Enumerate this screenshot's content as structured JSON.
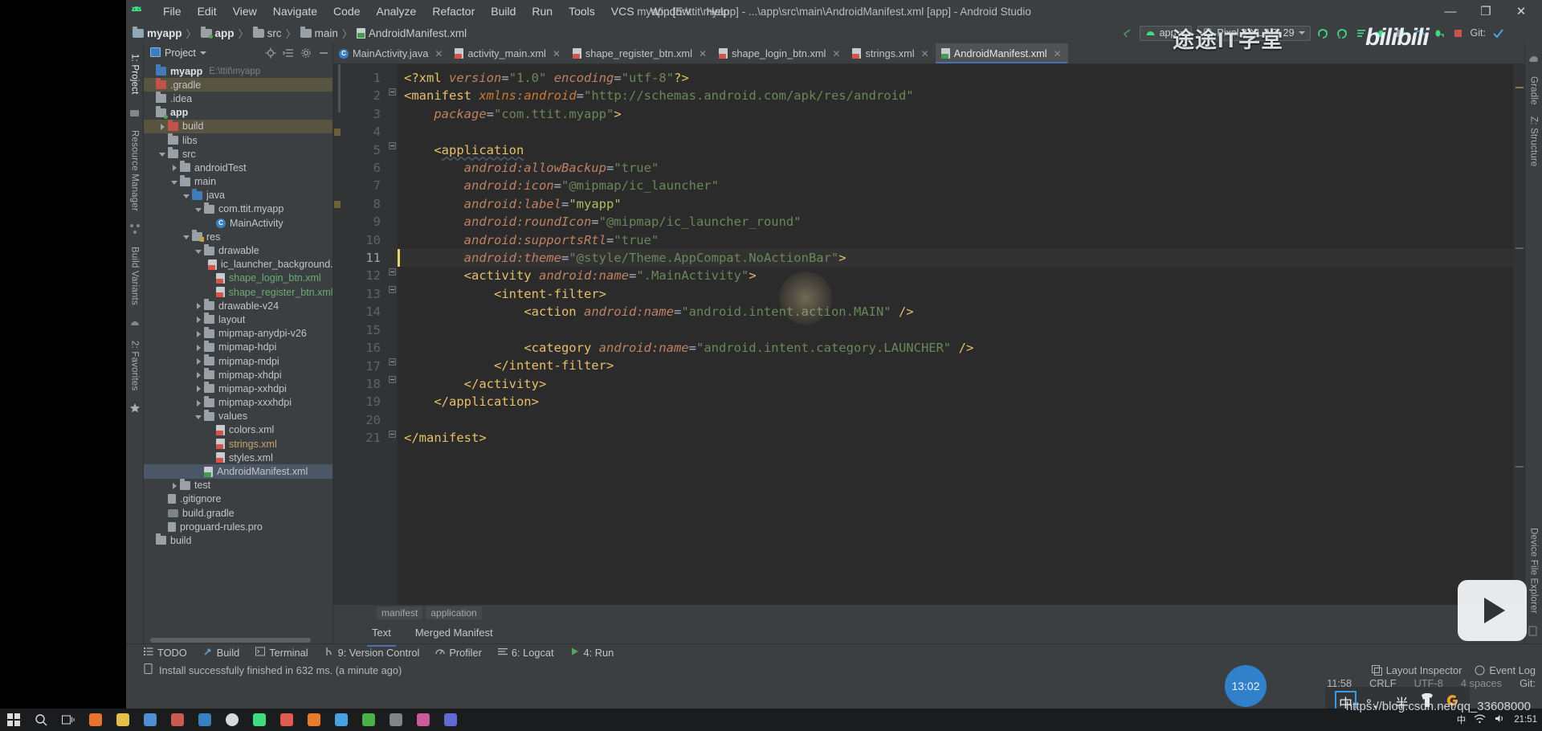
{
  "window": {
    "title": "myapp [E:\\ttit\\myapp] - ...\\app\\src\\main\\AndroidManifest.xml [app] - Android Studio",
    "minimize": "—",
    "maximize": "❐",
    "close": "✕"
  },
  "menubar": {
    "items": [
      "File",
      "Edit",
      "View",
      "Navigate",
      "Code",
      "Analyze",
      "Refactor",
      "Build",
      "Run",
      "Tools",
      "VCS",
      "Window",
      "Help"
    ]
  },
  "breadcrumb": {
    "items": [
      "myapp",
      "app",
      "src",
      "main",
      "AndroidManifest.xml"
    ],
    "separator": "〉"
  },
  "toolbar": {
    "module_selector": "app",
    "device_selector": "Pixel 3 XL API 29",
    "git_label": "Git:",
    "icons": [
      "back-arrow-icon",
      "run-icon",
      "debug-run-icon",
      "apply-changes-icon",
      "debug-icon",
      "profile-icon",
      "attach-debugger-icon",
      "stop-icon",
      "git-update-icon"
    ]
  },
  "project_panel": {
    "title": "Project",
    "actions": [
      "locate-icon",
      "collapse-all-icon",
      "settings-icon",
      "hide-icon"
    ],
    "tree": [
      {
        "indent": 0,
        "arrow": "none",
        "icon": "module-root",
        "label": "myapp",
        "bold": true,
        "path": "E:\\ttit\\myapp",
        "sel": "none"
      },
      {
        "indent": 0,
        "arrow": "none",
        "icon": "folder-red",
        "label": ".gradle",
        "sel": "olive"
      },
      {
        "indent": 0,
        "arrow": "none",
        "icon": "folder",
        "label": ".idea",
        "sel": "none"
      },
      {
        "indent": 0,
        "arrow": "none",
        "icon": "folder-mod",
        "label": "app",
        "bold": true,
        "sel": "none"
      },
      {
        "indent": 1,
        "arrow": "closed",
        "icon": "folder-red",
        "label": "build",
        "sel": "olive"
      },
      {
        "indent": 1,
        "arrow": "none",
        "icon": "folder",
        "label": "libs",
        "sel": "none"
      },
      {
        "indent": 1,
        "arrow": "open",
        "icon": "folder",
        "label": "src",
        "sel": "none"
      },
      {
        "indent": 2,
        "arrow": "closed",
        "icon": "folder",
        "label": "androidTest",
        "sel": "none"
      },
      {
        "indent": 2,
        "arrow": "open",
        "icon": "folder",
        "label": "main",
        "sel": "none"
      },
      {
        "indent": 3,
        "arrow": "open",
        "icon": "folder-blue",
        "label": "java",
        "sel": "none"
      },
      {
        "indent": 4,
        "arrow": "open",
        "icon": "folder-pkg",
        "label": "com.ttit.myapp",
        "sel": "none"
      },
      {
        "indent": 5,
        "arrow": "none",
        "icon": "class",
        "label": "MainActivity",
        "sel": "none"
      },
      {
        "indent": 3,
        "arrow": "open",
        "icon": "folder-res",
        "label": "res",
        "sel": "none"
      },
      {
        "indent": 4,
        "arrow": "open",
        "icon": "folder",
        "label": "drawable",
        "sel": "none"
      },
      {
        "indent": 5,
        "arrow": "none",
        "icon": "xml",
        "label": "ic_launcher_background.xml",
        "sel": "none"
      },
      {
        "indent": 5,
        "arrow": "none",
        "icon": "xml",
        "label": "shape_login_btn.xml",
        "color": "green",
        "sel": "none"
      },
      {
        "indent": 5,
        "arrow": "none",
        "icon": "xml",
        "label": "shape_register_btn.xml",
        "color": "green",
        "sel": "none"
      },
      {
        "indent": 4,
        "arrow": "closed",
        "icon": "folder",
        "label": "drawable-v24",
        "sel": "none"
      },
      {
        "indent": 4,
        "arrow": "closed",
        "icon": "folder",
        "label": "layout",
        "sel": "none"
      },
      {
        "indent": 4,
        "arrow": "closed",
        "icon": "folder",
        "label": "mipmap-anydpi-v26",
        "sel": "none"
      },
      {
        "indent": 4,
        "arrow": "closed",
        "icon": "folder",
        "label": "mipmap-hdpi",
        "sel": "none"
      },
      {
        "indent": 4,
        "arrow": "closed",
        "icon": "folder",
        "label": "mipmap-mdpi",
        "sel": "none"
      },
      {
        "indent": 4,
        "arrow": "closed",
        "icon": "folder",
        "label": "mipmap-xhdpi",
        "sel": "none"
      },
      {
        "indent": 4,
        "arrow": "closed",
        "icon": "folder",
        "label": "mipmap-xxhdpi",
        "sel": "none"
      },
      {
        "indent": 4,
        "arrow": "closed",
        "icon": "folder",
        "label": "mipmap-xxxhdpi",
        "sel": "none"
      },
      {
        "indent": 4,
        "arrow": "open",
        "icon": "folder",
        "label": "values",
        "sel": "none"
      },
      {
        "indent": 5,
        "arrow": "none",
        "icon": "xml",
        "label": "colors.xml",
        "sel": "none"
      },
      {
        "indent": 5,
        "arrow": "none",
        "icon": "xml",
        "label": "strings.xml",
        "color": "orange",
        "sel": "none"
      },
      {
        "indent": 5,
        "arrow": "none",
        "icon": "xml",
        "label": "styles.xml",
        "sel": "none"
      },
      {
        "indent": 4,
        "arrow": "none",
        "icon": "xml-mf",
        "label": "AndroidManifest.xml",
        "sel": "blue"
      },
      {
        "indent": 2,
        "arrow": "closed",
        "icon": "folder",
        "label": "test",
        "sel": "none"
      },
      {
        "indent": 1,
        "arrow": "none",
        "icon": "generic",
        "label": ".gitignore",
        "sel": "none"
      },
      {
        "indent": 1,
        "arrow": "none",
        "icon": "gradle",
        "label": "build.gradle",
        "sel": "none"
      },
      {
        "indent": 1,
        "arrow": "none",
        "icon": "generic",
        "label": "proguard-rules.pro",
        "sel": "none"
      },
      {
        "indent": 0,
        "arrow": "none",
        "icon": "folder",
        "label": "build",
        "sel": "none"
      }
    ]
  },
  "left_strip": {
    "tabs": [
      "1: Project",
      "Resource Manager",
      "Build Variants",
      "2: Favorites"
    ]
  },
  "right_strip": {
    "tabs": [
      "Gradle",
      "Z: Structure",
      "Device File Explorer"
    ]
  },
  "editor_tabs": [
    {
      "label": "MainActivity.java",
      "icon": "java-class-icon",
      "active": false
    },
    {
      "label": "activity_main.xml",
      "icon": "xml-file-icon",
      "active": false
    },
    {
      "label": "shape_register_btn.xml",
      "icon": "xml-file-icon",
      "active": false
    },
    {
      "label": "shape_login_btn.xml",
      "icon": "xml-file-icon",
      "active": false
    },
    {
      "label": "strings.xml",
      "icon": "xml-file-icon",
      "active": false
    },
    {
      "label": "AndroidManifest.xml",
      "icon": "xml-manifest-icon",
      "active": true
    }
  ],
  "code": {
    "line_numbers": [
      "1",
      "2",
      "3",
      "4",
      "5",
      "6",
      "7",
      "8",
      "9",
      "10",
      "11",
      "12",
      "13",
      "14",
      "15",
      "16",
      "17",
      "18",
      "19",
      "20",
      "21"
    ],
    "current_line": 11,
    "lines": [
      {
        "n": 1,
        "html": "<span class='tag'>&lt;?xml</span> <span class='aname'>version</span><span class='punct'>=</span><span class='str'>\"1.0\"</span> <span class='aname'>encoding</span><span class='punct'>=</span><span class='str'>\"utf-8\"</span><span class='tag'>?&gt;</span>"
      },
      {
        "n": 2,
        "html": "<span class='tag'>&lt;manifest</span> <span class='ns'>xmlns:android</span><span class='punct'>=</span><span class='str'>\"http://schemas.android.com/apk/res/android\"</span>"
      },
      {
        "n": 3,
        "html": "    <span class='aname'>package</span><span class='punct'>=</span><span class='str'>\"com.ttit.myapp\"</span><span class='tag'>&gt;</span>"
      },
      {
        "n": 4,
        "html": ""
      },
      {
        "n": 5,
        "html": "    <span class='tag'>&lt;</span><span class='tag err-underline'>application</span>"
      },
      {
        "n": 6,
        "html": "        <span class='aname'>android:allowBackup</span><span class='punct'>=</span><span class='str'>\"true\"</span>"
      },
      {
        "n": 7,
        "html": "        <span class='aname'>android:icon</span><span class='punct'>=</span><span class='str'>\"@mipmap/ic_launcher\"</span>"
      },
      {
        "n": 8,
        "html": "        <span class='aname'>android:label</span><span class='punct'>=</span><span class='strv'>\"myapp\"</span>"
      },
      {
        "n": 9,
        "html": "        <span class='aname'>android:roundIcon</span><span class='punct'>=</span><span class='str'>\"@mipmap/ic_launcher_round\"</span>"
      },
      {
        "n": 10,
        "html": "        <span class='aname'>android:supportsRtl</span><span class='punct'>=</span><span class='str'>\"true\"</span>"
      },
      {
        "n": 11,
        "html": "        <span class='aname'>android:theme</span><span class='punct'>=</span><span class='str'>\"@style/Theme.AppCompat.NoActionBar\"</span><span class='tag'>&gt;</span>"
      },
      {
        "n": 12,
        "html": "        <span class='tag'>&lt;activity</span> <span class='aname'>android:name</span><span class='punct'>=</span><span class='str'>\".MainActivity\"</span><span class='tag'>&gt;</span>"
      },
      {
        "n": 13,
        "html": "            <span class='tag'>&lt;intent-filter&gt;</span>"
      },
      {
        "n": 14,
        "html": "                <span class='tag'>&lt;action</span> <span class='aname'>android:name</span><span class='punct'>=</span><span class='str'>\"android.intent.action.MAIN\"</span> <span class='tag'>/&gt;</span>"
      },
      {
        "n": 15,
        "html": ""
      },
      {
        "n": 16,
        "html": "                <span class='tag'>&lt;category</span> <span class='aname'>android:name</span><span class='punct'>=</span><span class='str'>\"android.intent.category.LAUNCHER\"</span> <span class='tag'>/&gt;</span>"
      },
      {
        "n": 17,
        "html": "            <span class='tag'>&lt;/intent-filter&gt;</span>"
      },
      {
        "n": 18,
        "html": "        <span class='tag'>&lt;/activity&gt;</span>"
      },
      {
        "n": 19,
        "html": "    <span class='tag'>&lt;/application&gt;</span>"
      },
      {
        "n": 20,
        "html": ""
      },
      {
        "n": 21,
        "html": "<span class='tag'>&lt;/manifest&gt;</span>"
      }
    ]
  },
  "editor_breadcrumb": [
    "manifest",
    "application"
  ],
  "editor_footer_tabs": [
    {
      "label": "Text",
      "active": true
    },
    {
      "label": "Merged Manifest",
      "active": false
    }
  ],
  "tool_windows": [
    {
      "label": "TODO",
      "icon": "todo-icon"
    },
    {
      "label": "Build",
      "icon": "build-icon"
    },
    {
      "label": "Terminal",
      "icon": "terminal-icon"
    },
    {
      "label": "9: Version Control",
      "icon": "vcs-icon"
    },
    {
      "label": "Profiler",
      "icon": "profiler-icon"
    },
    {
      "label": "6: Logcat",
      "icon": "logcat-icon"
    },
    {
      "label": "4: Run",
      "icon": "run-icon"
    }
  ],
  "status_bar": {
    "message": "Install successfully finished in 632 ms. (a minute ago)",
    "caret_position": "11:58",
    "line_separator": "CRLF",
    "encoding": "UTF-8",
    "indent": "4 spaces",
    "git_branch": "Git:",
    "layout_inspector": "Layout Inspector",
    "event_log": "Event Log"
  },
  "taskbar": {
    "clock": "21:51",
    "ime_indicator": "中",
    "items": [
      "start-icon",
      "search-icon",
      "task-view-icon",
      "app-icon-1",
      "app-icon-2",
      "app-icon-3",
      "app-icon-4",
      "app-icon-5",
      "app-icon-6",
      "app-icon-7",
      "app-icon-8",
      "app-icon-9",
      "app-icon-10",
      "app-icon-11",
      "app-icon-12",
      "app-icon-13",
      "app-icon-14"
    ]
  },
  "overlays": {
    "watermark_cn": "途途IT学堂",
    "watermark_bili": "bilibili",
    "clock_bubble": "13:02",
    "url": "https://blog.csdn.net/qq_33608000",
    "ime_keys": [
      "中",
      "°，",
      "半",
      "shirt-icon",
      "g-icon"
    ]
  }
}
